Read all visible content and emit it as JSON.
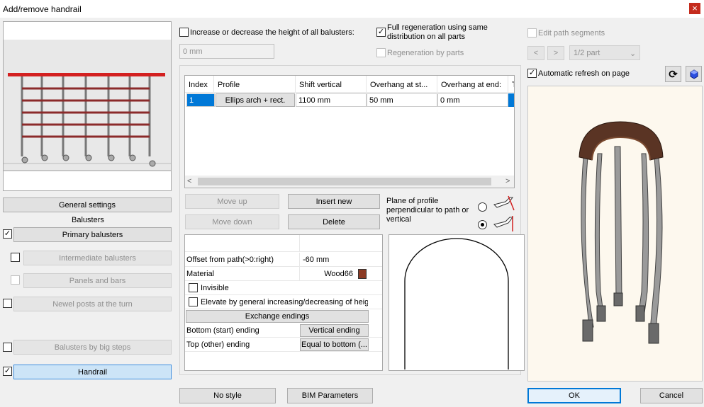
{
  "window": {
    "title": "Add/remove handrail",
    "close_glyph": "×"
  },
  "left": {
    "general_settings": "General settings",
    "balusters_heading": "Balusters",
    "primary": "Primary balusters",
    "intermediate": "Intermediate balusters",
    "panels": "Panels and bars",
    "newel": "Newel posts at the turn",
    "big_steps": "Balusters by big steps",
    "handrail": "Handrail"
  },
  "top": {
    "height_label": "Increase or decrease the height of all balusters:",
    "height_value": "0 mm",
    "full_regen": "Full regeneration using same distribution on all parts",
    "regen_by_parts": "Regeneration by parts"
  },
  "grid": {
    "headers": [
      "Index",
      "Profile",
      "Shift vertical",
      "Overhang at st...",
      "Overhang at end:",
      "T"
    ],
    "row": {
      "index": "1",
      "profile": "Ellips arch + rect.",
      "shift": "1100 mm",
      "overhang_start": "50 mm",
      "overhang_end": "0 mm"
    },
    "scroll_left": "<",
    "scroll_right": ">"
  },
  "actions": {
    "move_up": "Move up",
    "insert_new": "Insert new",
    "move_down": "Move down",
    "delete": "Delete",
    "plane_label": "Plane of profile perpendicular to path or vertical"
  },
  "props": {
    "offset_label": "Offset from path(>0:right)",
    "offset_value": "-60 mm",
    "material_label": "Material",
    "material_value": "Wood66",
    "material_color": "#8b3a24",
    "invisible_label": "Invisible",
    "elevate_label": "Elevate by general increasing/decreasing of height",
    "exchange": "Exchange endings",
    "bottom_label": "Bottom (start) ending",
    "bottom_value": "Vertical ending",
    "top_label": "Top (other) ending",
    "top_value": "Equal to bottom (..."
  },
  "right": {
    "edit_path": "Edit path segments",
    "prev": "<",
    "next": ">",
    "part_select": "1/2 part",
    "auto_refresh": "Automatic refresh on page"
  },
  "bottom": {
    "no_style": "No style",
    "bim": "BIM Parameters",
    "ok": "OK",
    "cancel": "Cancel"
  },
  "colors": {
    "rail": "#d32020",
    "bars": "#8b2a2a",
    "handrail_wood": "#5a3424"
  }
}
